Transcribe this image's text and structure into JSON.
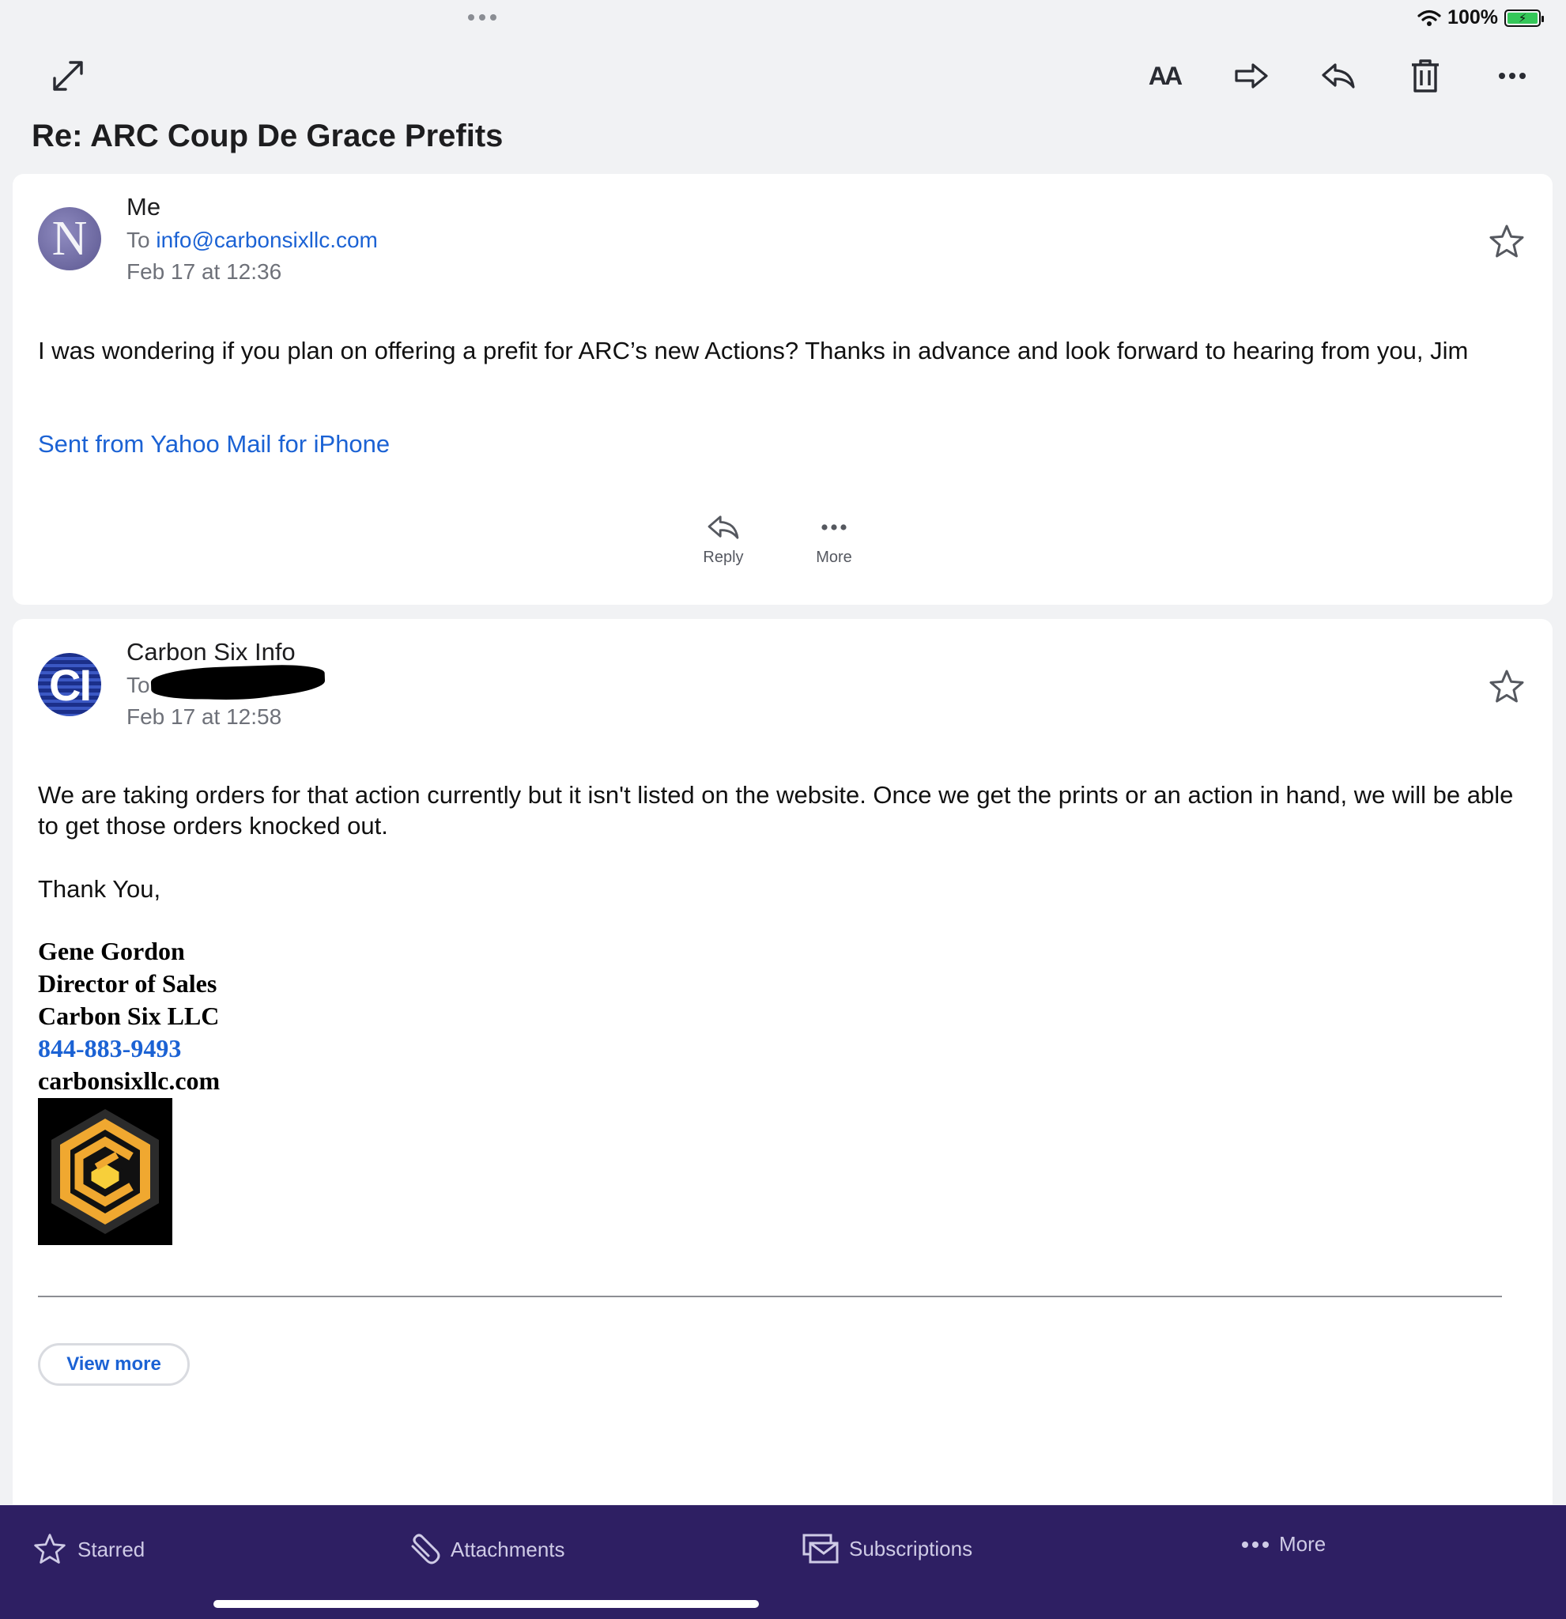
{
  "status_bar": {
    "battery_percent": "100%"
  },
  "toolbar": {
    "font_icon_text": "AA",
    "icons": [
      "expand-icon",
      "font-size-icon",
      "forward-icon",
      "reply-icon",
      "trash-icon",
      "more-icon"
    ]
  },
  "subject": "Re: ARC Coup De Grace Prefits",
  "message1": {
    "avatar_letter": "N",
    "sender": "Me",
    "to_prefix": "To",
    "to_address": "info@carbonsixllc.com",
    "date": "Feb 17 at 12:36",
    "body": "I was wondering if you plan on offering a prefit for ARC’s new Actions? Thanks in advance and look forward to hearing from you, Jim",
    "signature_link": "Sent from Yahoo Mail for iPhone",
    "actions": {
      "reply_label": "Reply",
      "more_label": "More"
    }
  },
  "message2": {
    "avatar_letters": "CI",
    "sender": "Carbon Six Info",
    "to_prefix": "To",
    "date": "Feb 17 at 12:58",
    "body": "We are taking orders for that action currently but it isn't listed on the website. Once we get the prints or an action in hand, we will be able to get those orders knocked out.",
    "closing": "Thank You,",
    "signature": {
      "name": "Gene Gordon",
      "title": "Director of Sales",
      "company": "Carbon Six LLC",
      "phone": "844-883-9493",
      "website": "carbonsixllc.com"
    },
    "view_more_label": "View more"
  },
  "colors": {
    "accent_blue": "#1b62d4",
    "bottom_bar": "#2e1f63",
    "logo_gold": "#f0a830"
  },
  "bottom_nav": {
    "starred": "Starred",
    "attachments": "Attachments",
    "subscriptions": "Subscriptions",
    "more": "More"
  }
}
